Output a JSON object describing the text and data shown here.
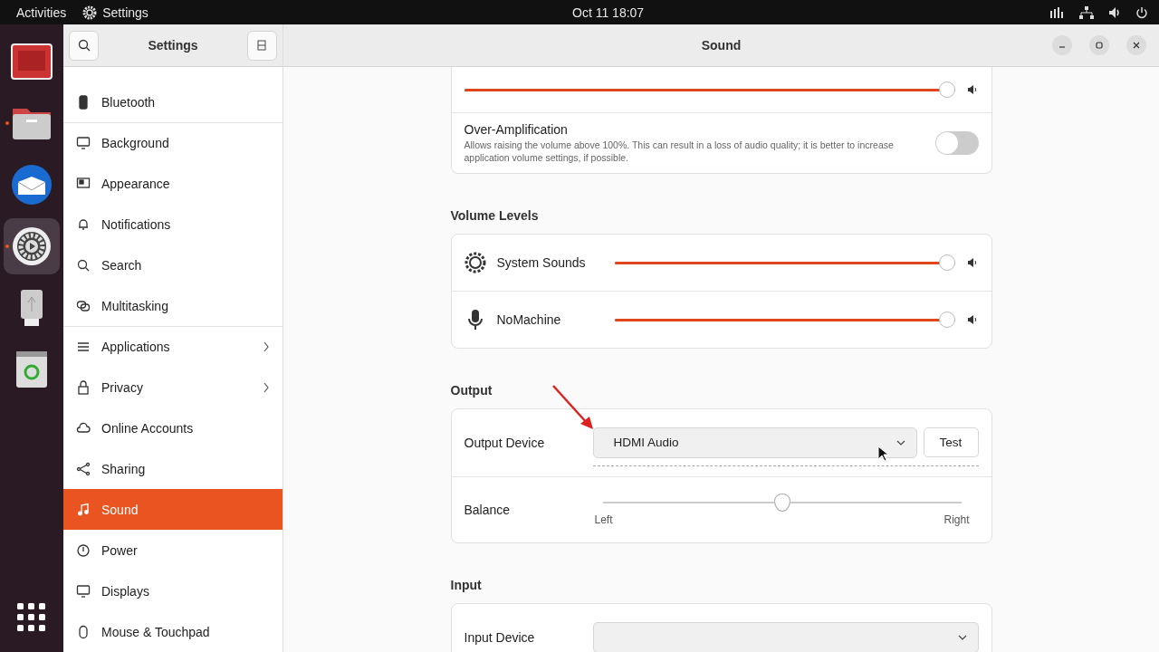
{
  "top_bar": {
    "activities": "Activities",
    "app_menu": "Settings",
    "clock": "Oct 11  18:07"
  },
  "dock": [
    {
      "running": false,
      "selected": false
    },
    {
      "running": true,
      "selected": false
    },
    {
      "running": false,
      "selected": false
    },
    {
      "running": true,
      "selected": true
    },
    {
      "running": false,
      "selected": false
    },
    {
      "running": false,
      "selected": false
    }
  ],
  "sidebar": {
    "title": "Settings",
    "items": [
      {
        "label": "Bluetooth",
        "selected": false,
        "divider_before": false,
        "submenu": false
      },
      {
        "label": "Background",
        "selected": false,
        "divider_before": true,
        "submenu": false
      },
      {
        "label": "Appearance",
        "selected": false,
        "divider_before": false,
        "submenu": false
      },
      {
        "label": "Notifications",
        "selected": false,
        "divider_before": false,
        "submenu": false
      },
      {
        "label": "Search",
        "selected": false,
        "divider_before": false,
        "submenu": false
      },
      {
        "label": "Multitasking",
        "selected": false,
        "divider_before": false,
        "submenu": false
      },
      {
        "label": "Applications",
        "selected": false,
        "divider_before": true,
        "submenu": true
      },
      {
        "label": "Privacy",
        "selected": false,
        "divider_before": false,
        "submenu": true
      },
      {
        "label": "Online Accounts",
        "selected": false,
        "divider_before": false,
        "submenu": false
      },
      {
        "label": "Sharing",
        "selected": false,
        "divider_before": false,
        "submenu": false
      },
      {
        "label": "Sound",
        "selected": true,
        "divider_before": false,
        "submenu": false
      },
      {
        "label": "Power",
        "selected": false,
        "divider_before": false,
        "submenu": false
      },
      {
        "label": "Displays",
        "selected": false,
        "divider_before": false,
        "submenu": false
      },
      {
        "label": "Mouse & Touchpad",
        "selected": false,
        "divider_before": false,
        "submenu": false
      }
    ]
  },
  "window": {
    "title": "Sound"
  },
  "sections": [
    {
      "rows": [
        {
          "kind": "volume",
          "level": 1
        },
        {
          "kind": "switch",
          "title": "Over-Amplification",
          "description": "Allows raising the volume above 100%. This can result in a loss of audio quality; it is better to increase application volume settings, if possible.",
          "on": false
        }
      ]
    },
    {
      "title": "Volume Levels",
      "rows": [
        {
          "kind": "stream",
          "label": "System Sounds",
          "level": 1
        },
        {
          "kind": "stream",
          "label": "NoMachine",
          "level": 1
        }
      ]
    },
    {
      "title": "Output",
      "rows": [
        {
          "kind": "device",
          "label": "Output Device",
          "value": "HDMI Audio",
          "button": "Test",
          "annotated": true
        },
        {
          "kind": "balance",
          "label": "Balance",
          "level": 0.5,
          "left": "Left",
          "right": "Right"
        }
      ]
    },
    {
      "title": "Input",
      "rows": [
        {
          "kind": "device",
          "label": "Input Device",
          "annotated": false
        }
      ]
    }
  ]
}
